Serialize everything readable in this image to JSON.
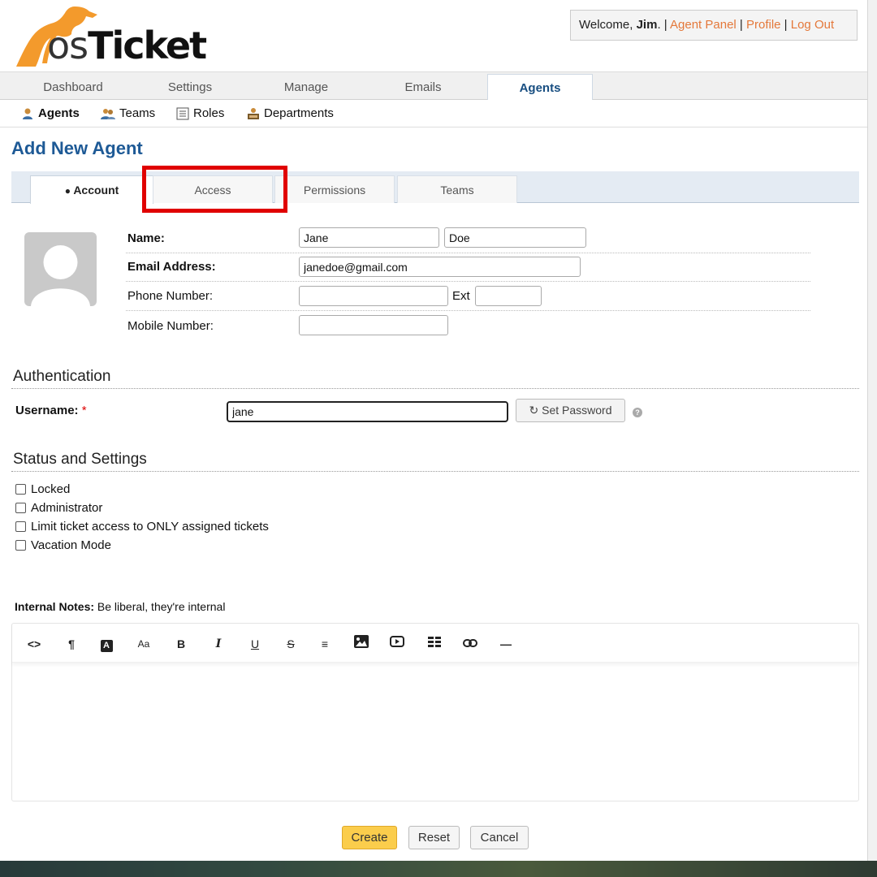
{
  "header": {
    "logo_text": "osTicket",
    "welcome_prefix": "Welcome, ",
    "user_name": "Jim",
    "welcome_sep": ". | ",
    "agent_panel": "Agent Panel",
    "sep": " | ",
    "profile": "Profile",
    "logout": "Log Out"
  },
  "nav": {
    "tabs": [
      {
        "label": "Dashboard"
      },
      {
        "label": "Settings"
      },
      {
        "label": "Manage"
      },
      {
        "label": "Emails"
      },
      {
        "label": "Agents"
      }
    ],
    "active": "Agents"
  },
  "subnav": {
    "items": [
      {
        "label": "Agents"
      },
      {
        "label": "Teams"
      },
      {
        "label": "Roles"
      },
      {
        "label": "Departments"
      }
    ]
  },
  "page_title": "Add New Agent",
  "form_tabs": [
    {
      "label": "Account"
    },
    {
      "label": "Access"
    },
    {
      "label": "Permissions"
    },
    {
      "label": "Teams"
    }
  ],
  "account": {
    "name_label": "Name:",
    "first_name": "Jane",
    "last_name": "Doe",
    "email_label": "Email Address:",
    "email": "janedoe@gmail.com",
    "phone_label": "Phone Number:",
    "phone": "",
    "ext_label": "Ext",
    "ext": "",
    "mobile_label": "Mobile Number:",
    "mobile": ""
  },
  "authentication": {
    "heading": "Authentication",
    "username_label": "Username:",
    "required_mark": "*",
    "username": "jane",
    "set_password": "Set Password",
    "help": "?"
  },
  "status": {
    "heading": "Status and Settings",
    "options": [
      {
        "label": "Locked",
        "checked": false
      },
      {
        "label": "Administrator",
        "checked": false
      },
      {
        "label": "Limit ticket access to ONLY assigned tickets",
        "checked": false
      },
      {
        "label": "Vacation Mode",
        "checked": false
      }
    ]
  },
  "notes": {
    "label": "Internal Notes:",
    "hint": "Be liberal, they're internal",
    "toolbar": [
      "<>",
      "¶",
      "A",
      "Aa",
      "B",
      "I",
      "U",
      "S",
      "≡",
      "image",
      "video",
      "table",
      "link",
      "—"
    ]
  },
  "actions": {
    "create": "Create",
    "reset": "Reset",
    "cancel": "Cancel"
  },
  "colors": {
    "brand_blue": "#1e5a96",
    "link_orange": "#e4783a",
    "highlight_red": "#e00000",
    "create_button": "#fbcd4c"
  }
}
